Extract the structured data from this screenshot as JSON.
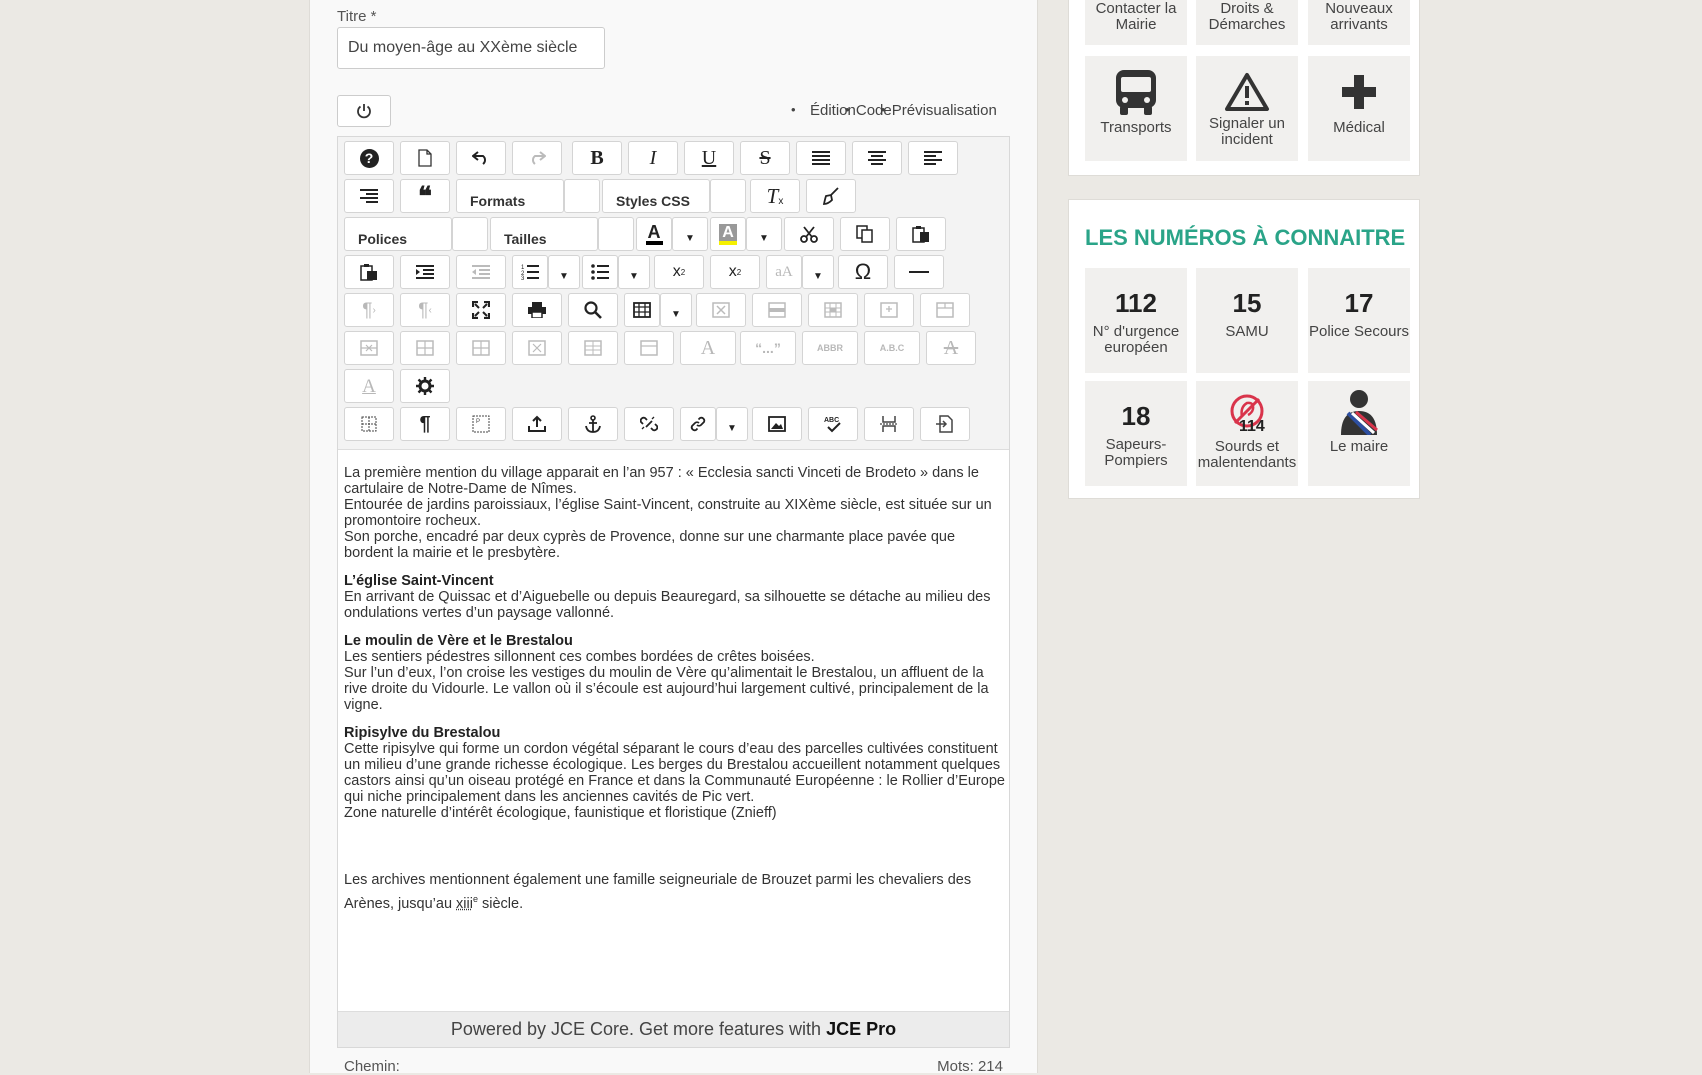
{
  "form": {
    "title_label": "Titre *",
    "title_value": "Du moyen-âge au XXème siècle",
    "view_tabs": [
      "Édition",
      "Code",
      "Prévisualisation"
    ]
  },
  "toolbar": {
    "formats_label": "Formats",
    "styles_label": "Styles CSS",
    "fonts_label": "Polices",
    "sizes_label": "Tailles",
    "text_color_accent": "#000000",
    "highlight_color_accent": "#f5f000",
    "quote_text": "“...”",
    "abbr_text": "ABBR",
    "acronym_text": "A.B.C",
    "help_icon_text": "?",
    "bold_text": "B",
    "italic_text": "I",
    "underline_text": "U",
    "strike_text": "S",
    "blockquote_text": "❝",
    "clear_format_text": "T",
    "text_color_text": "A",
    "highlight_text": "A",
    "subscript_text": "x",
    "superscript_text": "x",
    "fontsize_text": "aA",
    "omega_text": "Ω",
    "pilcrow_text": "¶"
  },
  "content": {
    "intro_1": "La première mention du village apparait en l’an 957 : « Ecclesia sancti Vinceti de Brodeto » dans le cartulaire de Notre-Dame de Nîmes.",
    "intro_2": "Entourée de jardins paroissiaux, l’église Saint-Vincent, construite au XIXème siècle, est située sur un promontoire rocheux.",
    "intro_3": "Son porche, encadré par deux cyprès de Provence, donne sur une charmante place pavée que bordent la mairie et le presbytère.",
    "h_eglise": "L’église Saint-Vincent",
    "p_eglise": "En arrivant de Quissac et d’Aiguebelle ou depuis Beauregard, sa silhouette se détache au milieu des ondulations vertes d’un paysage vallonné.",
    "h_moulin": "Le moulin de Vère et le Brestalou",
    "p_moulin_1": "Les sentiers pédestres sillonnent ces combes bordées de crêtes boisées.",
    "p_moulin_2": "Sur l’un d’eux, l’on croise les vestiges du moulin de Vère qu’alimentait le Brestalou, un affluent de la rive droite du Vidourle. Le vallon où il s’écoule est aujourd’hui largement cultivé, principalement de la vigne.",
    "h_ripi": "Ripisylve du Brestalou",
    "p_ripi_1": "Cette ripisylve qui forme un cordon végétal séparant le cours d’eau des parcelles cultivées constituent un milieu d’une grande richesse écologique. Les berges du Brestalou accueillent notamment quelques castors ainsi qu’un oiseau protégé en France et dans la Communauté Européenne : le Rollier d’Europe qui niche principalement dans les anciennes cavités de Pic vert.",
    "p_ripi_2": "Zone naturelle d’intérêt écologique, faunistique et floristique (Znieff)",
    "archives_1": "Les archives mentionnent également une famille seigneuriale de Brouzet parmi les chevaliers des Arènes, jusqu’au ",
    "archives_abbr": "xiii",
    "archives_sup": "e",
    "archives_2": " siècle."
  },
  "editor_footer": {
    "powered_text": "Powered by JCE Core. Get more features with",
    "powered_bold": "JCE Pro",
    "path_label": "Chemin:",
    "word_count": "Mots: 214"
  },
  "sidebar": {
    "top_tiles": [
      "Contacter la Mairie",
      "Droits & Démarches",
      "Nouveaux arrivants"
    ],
    "service_tiles": [
      {
        "label": "Transports",
        "icon": "bus-icon"
      },
      {
        "label": "Signaler un incident",
        "icon": "warning-icon"
      },
      {
        "label": "Médical",
        "icon": "plus-icon"
      }
    ],
    "numbers_heading": "LES NUMÉROS À CONNAITRE",
    "numbers": [
      {
        "number": "112",
        "label": "N° d'urgence européen"
      },
      {
        "number": "15",
        "label": "SAMU"
      },
      {
        "number": "17",
        "label": "Police Secours"
      },
      {
        "number": "18",
        "label": "Sapeurs-Pompiers"
      },
      {
        "number": "114",
        "label": "Sourds et malentendants"
      },
      {
        "number": "",
        "label": "Le maire"
      }
    ],
    "accent_color": "#2aa488"
  }
}
